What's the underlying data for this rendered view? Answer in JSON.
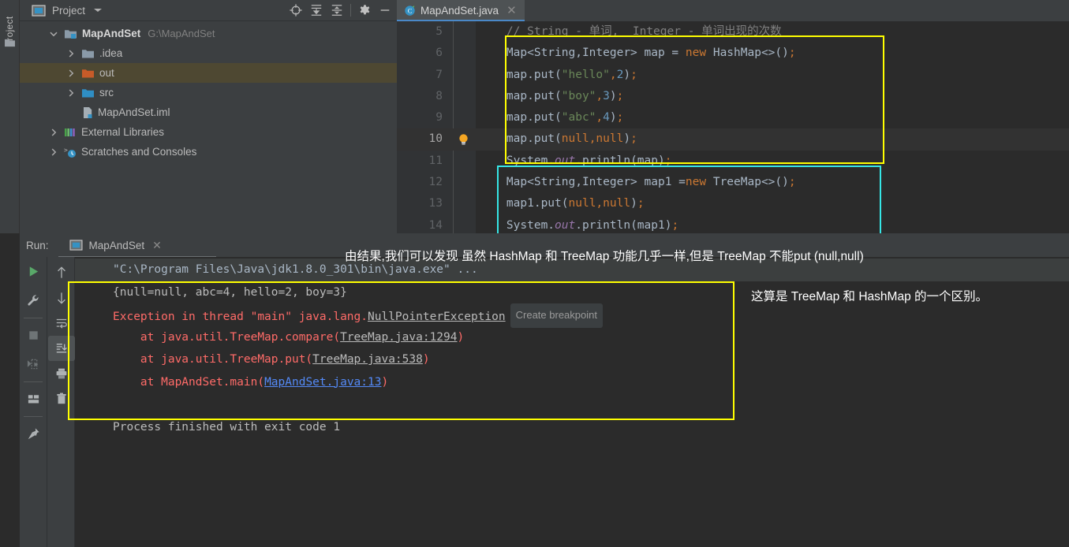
{
  "sidebar_strip": {
    "vertical_tab_label": "Project",
    "folder_icon": "folder-icon"
  },
  "project_panel": {
    "title": "Project",
    "caret_icon": "chevron-down-icon",
    "toolbar": [
      {
        "name": "locate-icon",
        "tooltip": "Select Opened File"
      },
      {
        "name": "expand-all-icon",
        "tooltip": "Expand All"
      },
      {
        "name": "collapse-all-icon",
        "tooltip": "Collapse All"
      },
      {
        "name": "gear-icon",
        "tooltip": "Settings"
      },
      {
        "name": "minimize-icon",
        "tooltip": "Hide"
      }
    ],
    "tree": [
      {
        "label": "MapAndSet",
        "detail": "G:\\MapAndSet",
        "indent": 0,
        "expanded": true,
        "icon": "module-folder-icon",
        "selected": false,
        "bold": true
      },
      {
        "label": ".idea",
        "detail": "",
        "indent": 1,
        "expanded": false,
        "icon": "folder-icon",
        "selected": false,
        "bold": false
      },
      {
        "label": "out",
        "detail": "",
        "indent": 1,
        "expanded": false,
        "icon": "folder-orange-icon",
        "selected": true,
        "bold": false
      },
      {
        "label": "src",
        "detail": "",
        "indent": 1,
        "expanded": false,
        "icon": "folder-source-icon",
        "selected": false,
        "bold": false
      },
      {
        "label": "MapAndSet.iml",
        "detail": "",
        "indent": 2,
        "expanded": null,
        "icon": "iml-file-icon",
        "selected": false,
        "bold": false
      },
      {
        "label": "External Libraries",
        "detail": "",
        "indent": 0,
        "expanded": false,
        "icon": "libraries-icon",
        "selected": false,
        "bold": false
      },
      {
        "label": "Scratches and Consoles",
        "detail": "",
        "indent": 0,
        "expanded": false,
        "icon": "scratches-icon",
        "selected": false,
        "bold": false
      }
    ]
  },
  "editor": {
    "tab": {
      "filename": "MapAndSet.java",
      "icon": "java-class-icon",
      "close_icon": "close-icon"
    },
    "lines": [
      {
        "num": "5",
        "current": false,
        "bulb": false,
        "tokens": [
          {
            "c": "t-cmt",
            "t": "    // String - 单词,  Integer - 单词出现的次数"
          }
        ]
      },
      {
        "num": "6",
        "current": false,
        "bulb": false,
        "tokens": [
          {
            "c": "t-def",
            "t": "    Map<String,Integer> map = "
          },
          {
            "c": "t-kw",
            "t": "new"
          },
          {
            "c": "t-def",
            "t": " HashMap<>()"
          },
          {
            "c": "t-sem",
            "t": ";"
          }
        ]
      },
      {
        "num": "7",
        "current": false,
        "bulb": false,
        "tokens": [
          {
            "c": "t-def",
            "t": "    map.put("
          },
          {
            "c": "t-str",
            "t": "\"hello\""
          },
          {
            "c": "t-sem",
            "t": ","
          },
          {
            "c": "t-num",
            "t": "2"
          },
          {
            "c": "t-def",
            "t": ")"
          },
          {
            "c": "t-sem",
            "t": ";"
          }
        ]
      },
      {
        "num": "8",
        "current": false,
        "bulb": false,
        "tokens": [
          {
            "c": "t-def",
            "t": "    map.put("
          },
          {
            "c": "t-str",
            "t": "\"boy\""
          },
          {
            "c": "t-sem",
            "t": ","
          },
          {
            "c": "t-num",
            "t": "3"
          },
          {
            "c": "t-def",
            "t": ")"
          },
          {
            "c": "t-sem",
            "t": ";"
          }
        ]
      },
      {
        "num": "9",
        "current": false,
        "bulb": false,
        "tokens": [
          {
            "c": "t-def",
            "t": "    map.put("
          },
          {
            "c": "t-str",
            "t": "\"abc\""
          },
          {
            "c": "t-sem",
            "t": ","
          },
          {
            "c": "t-num",
            "t": "4"
          },
          {
            "c": "t-def",
            "t": ")"
          },
          {
            "c": "t-sem",
            "t": ";"
          }
        ]
      },
      {
        "num": "10",
        "current": true,
        "bulb": true,
        "tokens": [
          {
            "c": "t-def",
            "t": "    map.put("
          },
          {
            "c": "t-kw",
            "t": "null"
          },
          {
            "c": "t-sem",
            "t": ","
          },
          {
            "c": "t-kw",
            "t": "null"
          },
          {
            "c": "t-def",
            "t": ")"
          },
          {
            "c": "t-sem",
            "t": ";"
          }
        ]
      },
      {
        "num": "11",
        "current": false,
        "bulb": false,
        "tokens": [
          {
            "c": "t-def",
            "t": "    System."
          },
          {
            "c": "t-fld",
            "t": "out"
          },
          {
            "c": "t-def",
            "t": ".println(map)"
          },
          {
            "c": "t-sem",
            "t": ";"
          }
        ]
      },
      {
        "num": "12",
        "current": false,
        "bulb": false,
        "tokens": [
          {
            "c": "t-def",
            "t": "    Map<String,Integer> map1 ="
          },
          {
            "c": "t-kw",
            "t": "new"
          },
          {
            "c": "t-def",
            "t": " TreeMap<>()"
          },
          {
            "c": "t-sem",
            "t": ";"
          }
        ]
      },
      {
        "num": "13",
        "current": false,
        "bulb": false,
        "tokens": [
          {
            "c": "t-def",
            "t": "    map1.put("
          },
          {
            "c": "t-kw",
            "t": "null"
          },
          {
            "c": "t-sem",
            "t": ","
          },
          {
            "c": "t-kw",
            "t": "null"
          },
          {
            "c": "t-def",
            "t": ")"
          },
          {
            "c": "t-sem",
            "t": ";"
          }
        ]
      },
      {
        "num": "14",
        "current": false,
        "bulb": false,
        "tokens": [
          {
            "c": "t-def",
            "t": "    System."
          },
          {
            "c": "t-fld",
            "t": "out"
          },
          {
            "c": "t-def",
            "t": ".println(map1)"
          },
          {
            "c": "t-sem",
            "t": ";"
          }
        ]
      }
    ]
  },
  "run_panel": {
    "label": "Run:",
    "tab": {
      "name": "MapAndSet",
      "icon": "run-config-icon",
      "close_icon": "close-icon"
    },
    "left_toolbar": [
      {
        "name": "run-icon",
        "tooltip": "Rerun"
      },
      {
        "name": "wrench-icon",
        "tooltip": "Edit Configuration"
      },
      {
        "name": "stop-icon",
        "tooltip": "Stop"
      },
      {
        "name": "resume-icon",
        "tooltip": "Resume"
      },
      {
        "name": "layout-icon",
        "tooltip": "Layout Settings"
      },
      {
        "name": "pin-icon",
        "tooltip": "Pin Tab"
      }
    ],
    "console_toolbar": [
      {
        "name": "arrow-up-icon",
        "tooltip": "Up the Stack Trace",
        "active": false
      },
      {
        "name": "arrow-down-icon",
        "tooltip": "Down the Stack Trace",
        "active": false
      },
      {
        "name": "soft-wrap-icon",
        "tooltip": "Soft-Wrap",
        "active": false
      },
      {
        "name": "scroll-to-end-icon",
        "tooltip": "Scroll to the End",
        "active": true
      },
      {
        "name": "print-icon",
        "tooltip": "Print",
        "active": false
      },
      {
        "name": "trash-icon",
        "tooltip": "Clear All",
        "active": false
      }
    ],
    "console": [
      {
        "kind": "cmd",
        "segments": [
          {
            "c": "co-cmd",
            "t": "\"C:\\Program Files\\Java\\jdk1.8.0_301\\bin\\java.exe\" ..."
          }
        ]
      },
      {
        "kind": "out",
        "segments": [
          {
            "c": "co-out",
            "t": "{null=null, abc=4, hello=2, boy=3}"
          }
        ]
      },
      {
        "kind": "err",
        "segments": [
          {
            "c": "co-err",
            "t": "Exception in thread \"main\" java.lang."
          },
          {
            "c": "co-link",
            "t": "NullPointerException"
          },
          {
            "c": "hint",
            "t": "Create breakpoint"
          }
        ]
      },
      {
        "kind": "err",
        "segments": [
          {
            "c": "co-err",
            "t": "    at java.util.TreeMap.compare("
          },
          {
            "c": "co-link",
            "t": "TreeMap.java:1294"
          },
          {
            "c": "co-err",
            "t": ")"
          }
        ]
      },
      {
        "kind": "err",
        "segments": [
          {
            "c": "co-err",
            "t": "    at java.util.TreeMap.put("
          },
          {
            "c": "co-link",
            "t": "TreeMap.java:538"
          },
          {
            "c": "co-err",
            "t": ")"
          }
        ]
      },
      {
        "kind": "err",
        "segments": [
          {
            "c": "co-err",
            "t": "    at MapAndSet.main("
          },
          {
            "c": "co-link-blue",
            "t": "MapAndSet.java:13"
          },
          {
            "c": "co-err",
            "t": ")"
          }
        ]
      },
      {
        "kind": "gap",
        "segments": []
      },
      {
        "kind": "out",
        "segments": [
          {
            "c": "co-out",
            "t": "Process finished with exit code 1"
          }
        ]
      }
    ]
  },
  "annotations": [
    {
      "id": "anno-top",
      "text": "由结果,我们可以发现 虽然 HashMap 和 TreeMap 功能几乎一样,但是 TreeMap 不能put (null,null)"
    },
    {
      "id": "anno-right",
      "text": "这算是 TreeMap 和 HashMap 的一个区别。"
    }
  ],
  "highlights": [
    {
      "name": "hashmap-code-highlight",
      "color": "#ffff00"
    },
    {
      "name": "treemap-code-highlight",
      "color": "#36e6e6"
    },
    {
      "name": "console-output-highlight",
      "color": "#ffff00"
    }
  ],
  "colors": {
    "panel_bg": "#3c3f41",
    "editor_bg": "#2b2b2b",
    "gutter_bg": "#313335",
    "selection": "#4e4832",
    "accent": "#4a88c7",
    "error": "#ff6b68",
    "yellow_box": "#ffff00",
    "cyan_box": "#36e6e6"
  }
}
